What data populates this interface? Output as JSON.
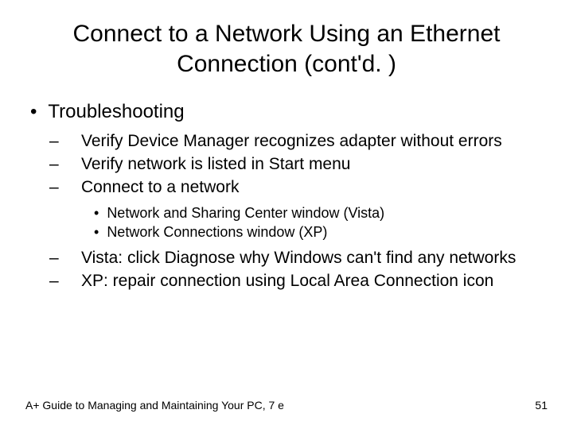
{
  "title": "Connect to a Network Using an Ethernet Connection (cont'd. )",
  "bullets": {
    "l1": "Troubleshooting",
    "l2a": "Verify Device Manager recognizes adapter without errors",
    "l2b": "Verify network is listed in Start menu",
    "l2c": "Connect to a network",
    "l3a": "Network and Sharing Center window (Vista)",
    "l3b": "Network Connections window (XP)",
    "l2d": "Vista: click Diagnose why Windows can't find any networks",
    "l2e": "XP: repair connection using Local Area Connection icon"
  },
  "footer": {
    "left": "A+ Guide to Managing and Maintaining Your PC, 7 e",
    "right": "51"
  }
}
